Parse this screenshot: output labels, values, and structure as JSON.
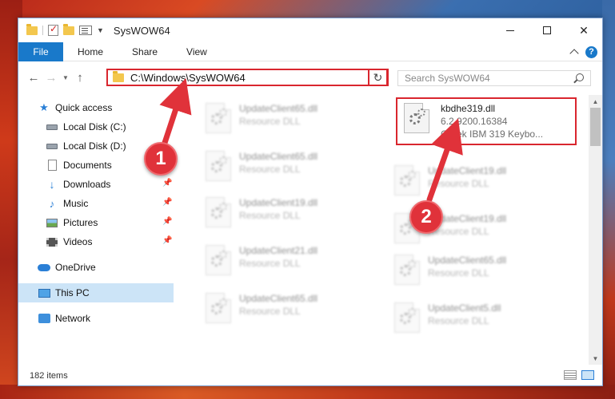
{
  "window": {
    "title": "SysWOW64",
    "controls": [
      "minimize",
      "maximize",
      "close"
    ]
  },
  "ribbon": {
    "tabs": [
      "File",
      "Home",
      "Share",
      "View"
    ],
    "help": "?"
  },
  "navigation": {
    "address": "C:\\Windows\\SysWOW64",
    "search_placeholder": "Search SysWOW64"
  },
  "sidebar": {
    "items": [
      {
        "label": "Quick access",
        "icon": "star-icon",
        "pinned": false
      },
      {
        "label": "Local Disk (C:)",
        "icon": "drive-icon",
        "pinned": false
      },
      {
        "label": "Local Disk (D:)",
        "icon": "drive-icon",
        "pinned": false
      },
      {
        "label": "Documents",
        "icon": "document-icon",
        "pinned": true
      },
      {
        "label": "Downloads",
        "icon": "download-icon",
        "pinned": true
      },
      {
        "label": "Music",
        "icon": "music-icon",
        "pinned": true
      },
      {
        "label": "Pictures",
        "icon": "pictures-icon",
        "pinned": true
      },
      {
        "label": "Videos",
        "icon": "videos-icon",
        "pinned": true
      },
      {
        "label": "OneDrive",
        "icon": "cloud-icon",
        "pinned": false
      },
      {
        "label": "This PC",
        "icon": "computer-icon",
        "pinned": false,
        "selected": true
      },
      {
        "label": "Network",
        "icon": "network-icon",
        "pinned": false
      }
    ]
  },
  "files": {
    "highlighted": {
      "name": "kbdhe319.dll",
      "version": "6.2.9200.16384",
      "description": "Greek IBM 319 Keybo..."
    },
    "tiles": [
      {
        "name": "UpdateClient65.dll",
        "type": "Resource DLL"
      },
      {
        "name": "UpdateClient65.dll",
        "type": "Resource DLL"
      },
      {
        "name": "UpdateClient19.dll",
        "type": "Resource DLL"
      },
      {
        "name": "UpdateClient21.dll",
        "type": "Resource DLL"
      },
      {
        "name": "UpdateClient65.dll",
        "type": "Resource DLL"
      },
      {
        "name": "UpdateClient19.dll",
        "type": "Resource DLL"
      },
      {
        "name": "UpdateClient19.dll",
        "type": "Resource DLL"
      },
      {
        "name": "UpdateClient65.dll",
        "type": "Resource DLL"
      },
      {
        "name": "UpdateClient5.dll",
        "type": "Resource DLL"
      }
    ]
  },
  "status": {
    "item_count": "182 items"
  },
  "callouts": [
    "1",
    "2"
  ],
  "colors": {
    "accent": "#1979ca",
    "highlight": "#d9262e",
    "callout": "#e0323a",
    "selection": "#cce4f7"
  }
}
